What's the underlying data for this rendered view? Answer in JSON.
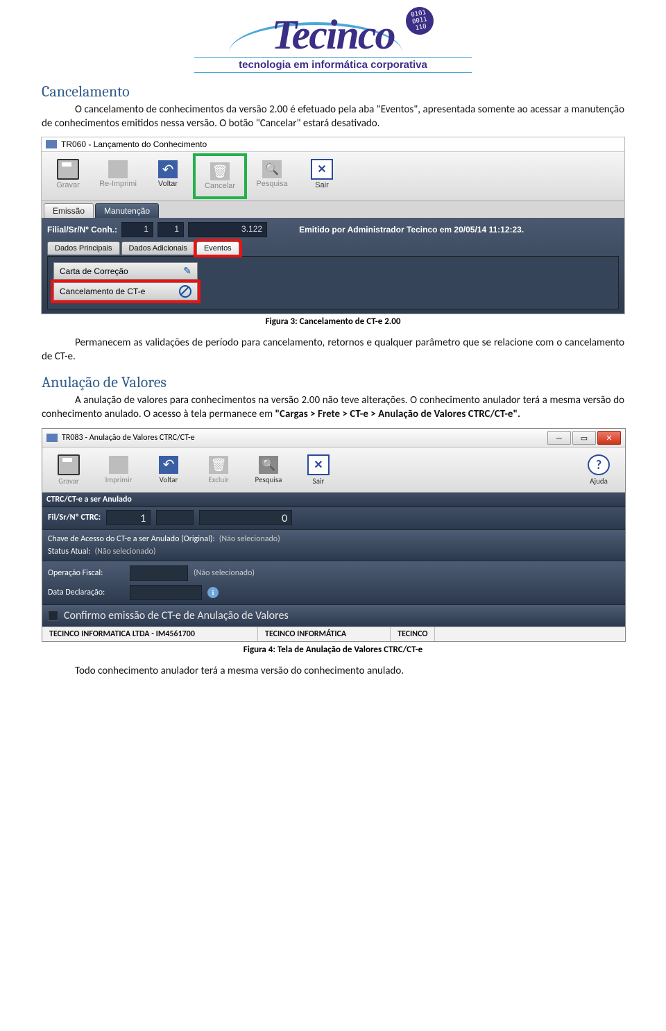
{
  "logo": {
    "name": "Tecinco",
    "tagline": "tecnologia em informática corporativa",
    "globe_bits": [
      "0101",
      "0011",
      "110"
    ]
  },
  "sec1": {
    "title": "Cancelamento",
    "p1_a": "O cancelamento de conhecimentos da versão 2.00 é efetuado pela aba \"Eventos\", apresentada somente ao acessar a manutenção de conhecimentos emitidos nessa versão. O botão \"Cancelar\" estará desativado.",
    "caption": "Figura 3: Cancelamento de CT-e 2.00",
    "p2": "Permanecem as validações de período para cancelamento, retornos e qualquer parâmetro que se relacione com o cancelamento de CT-e."
  },
  "shot1": {
    "title": "TR060 - Lançamento do Conhecimento",
    "toolbar": {
      "gravar": "Gravar",
      "reimprimir": "Re-Imprimi",
      "voltar": "Voltar",
      "cancelar": "Cancelar",
      "pesquisa": "Pesquisa",
      "sair": "Sair"
    },
    "topTabs": {
      "emissao": "Emissão",
      "manutencao": "Manutenção"
    },
    "filial_label": "Filial/Sr/Nº Conh.:",
    "filial_v1": "1",
    "filial_v2": "1",
    "filial_v3": "3.122",
    "emitted": "Emitido por Administrador Tecinco em 20/05/14 11:12:23.",
    "subtabs": {
      "dados": "Dados Principais",
      "adic": "Dados Adicionais",
      "eventos": "Eventos"
    },
    "links": {
      "carta": "Carta de Correção",
      "cancel": "Cancelamento de CT-e"
    }
  },
  "sec2": {
    "title": "Anulação de Valores",
    "p1_a": "A anulação de valores para conhecimentos na versão 2.00 não teve alterações. O conhecimento anulador terá a mesma versão do conhecimento anulado. O acesso à tela permanece em ",
    "p1_b": "\"Cargas > Frete > CT-e > Anulação de Valores CTRC/CT-e\".",
    "caption": "Figura 4: Tela de Anulação de Valores CTRC/CT-e",
    "p2": "Todo conhecimento anulador terá a mesma versão do conhecimento anulado."
  },
  "shot2": {
    "title": "TR083 - Anulação de Valores CTRC/CT-e",
    "toolbar": {
      "gravar": "Gravar",
      "imprimir": "Imprimir",
      "voltar": "Voltar",
      "excluir": "Excluir",
      "pesquisa": "Pesquisa",
      "sair": "Sair",
      "ajuda": "Ajuda"
    },
    "sect1_title": "CTRC/CT-e a ser Anulado",
    "fil_label": "Fil/Sr/Nº CTRC:",
    "fil_v1": "1",
    "fil_v2": "",
    "fil_v3": "0",
    "chave_lbl": "Chave de Acesso do CT-e a ser Anulado (Original):",
    "nao_sel": "(Não selecionado)",
    "status_lbl": "Status Atual:",
    "op_lbl": "Operação Fiscal:",
    "data_lbl": "Data Declaração:",
    "confirm": "Confirmo emissão de CT-e de Anulação de Valores",
    "footer": {
      "c1": "TECINCO INFORMATICA LTDA - IM4561700",
      "c2": "TECINCO INFORMÁTICA",
      "c3": "TECINCO"
    }
  }
}
